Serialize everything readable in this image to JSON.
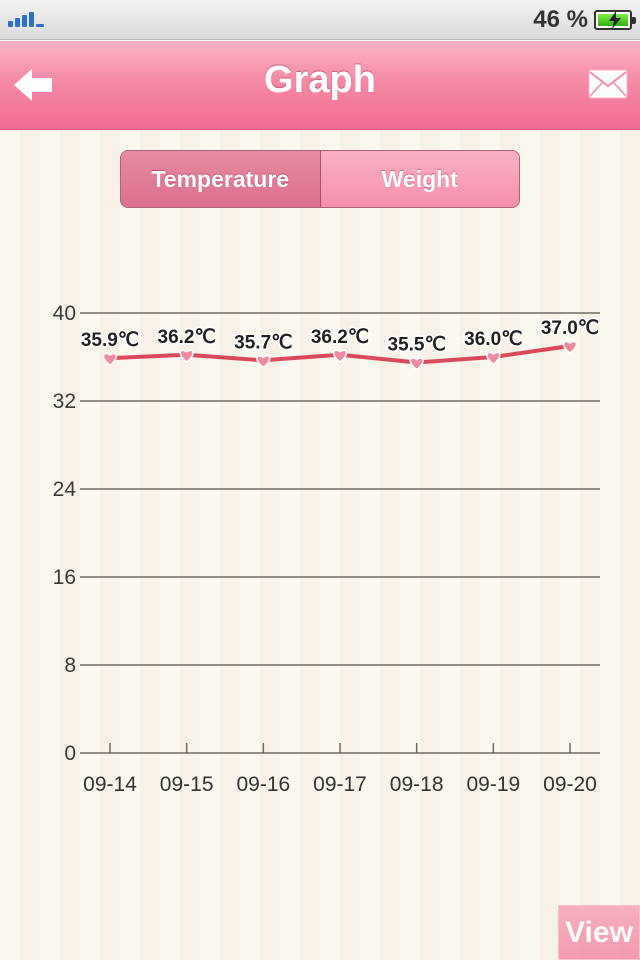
{
  "status_bar": {
    "battery_percent": "46 %"
  },
  "nav": {
    "title": "Graph",
    "back_icon": "arrow-left-icon",
    "mail_icon": "envelope-icon"
  },
  "tabs": [
    {
      "label": "Temperature",
      "selected": true
    },
    {
      "label": "Weight",
      "selected": false
    }
  ],
  "view_button": {
    "label": "View"
  },
  "colors": {
    "accent": "#f06d93",
    "line": "#d94b5b",
    "marker": "#f08aa0"
  },
  "chart_data": {
    "type": "line",
    "categories": [
      "09-14",
      "09-15",
      "09-16",
      "09-17",
      "09-18",
      "09-19",
      "09-20"
    ],
    "series": [
      {
        "values": [
          35.9,
          36.2,
          35.7,
          36.2,
          35.5,
          36.0,
          37.0
        ],
        "labels": [
          "35.9℃",
          "36.2℃",
          "35.7℃",
          "36.2℃",
          "35.5℃",
          "36.0℃",
          "37.0℃"
        ]
      }
    ],
    "yticks": [
      "0",
      "8",
      "16",
      "24",
      "32",
      "40"
    ],
    "ylim": [
      0,
      40
    ],
    "grid": true,
    "xlabel": "",
    "ylabel": ""
  }
}
